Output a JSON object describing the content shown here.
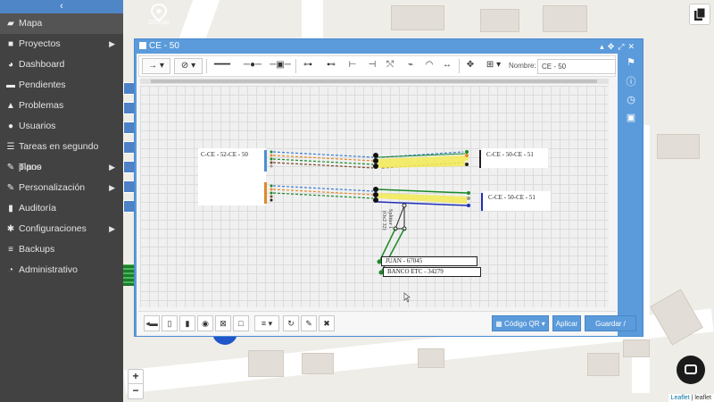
{
  "sidebar": {
    "toggle_icon": "chevron-left-icon",
    "items": [
      {
        "label": "Mapa",
        "icon": "map-icon",
        "submenu": false
      },
      {
        "label": "Proyectos",
        "icon": "folder-icon",
        "submenu": true
      },
      {
        "label": "Dashboard",
        "icon": "pie-chart-icon",
        "submenu": false
      },
      {
        "label": "Pendientes",
        "icon": "truck-icon",
        "submenu": false
      },
      {
        "label": "Problemas",
        "icon": "warning-icon",
        "submenu": false
      },
      {
        "label": "Usuarios",
        "icon": "user-icon",
        "submenu": false
      },
      {
        "label": "Tareas en segundo plano",
        "icon": "tasks-icon",
        "submenu": false
      },
      {
        "label": "Tipos",
        "icon": "wrench-icon",
        "submenu": true
      },
      {
        "label": "Personalización",
        "icon": "brush-icon",
        "submenu": true
      },
      {
        "label": "Auditoría",
        "icon": "book-icon",
        "submenu": false
      },
      {
        "label": "Configuraciones",
        "icon": "gear-icon",
        "submenu": true
      },
      {
        "label": "Backups",
        "icon": "database-icon",
        "submenu": false
      },
      {
        "label": "Administrativo",
        "icon": "dashboard-icon",
        "submenu": false
      }
    ]
  },
  "logo": {
    "text": "OZmap"
  },
  "dialog": {
    "title": "CE - 50",
    "toolbar": {
      "name_label": "Nombre:",
      "name_value": "CE - 50"
    },
    "bottombar": {
      "qr_label": "Código QR",
      "apply_label": "Aplicar",
      "save_close_label": "Guardar / Cerrar"
    }
  },
  "diagram": {
    "left_box_label": "C-CE - 52-CE - 50",
    "right_box_top_label": "C-CE - 50-CE - 51",
    "right_box_bottom_label": "C-CE - 50-CE - 51",
    "splitter_label": "Splitter 1",
    "splitter_sublabel": "(Oe2 32)",
    "clients": [
      {
        "label": "JUAN - 67045"
      },
      {
        "label": "BANCO ETC - 34279"
      }
    ]
  },
  "map": {
    "zoom_in": "+",
    "zoom_out": "−",
    "attribution_link": "Leaflet",
    "attribution_text": " | leaflet"
  },
  "colors": {
    "sidebar_bg": "#424242",
    "accent": "#5b9bdb",
    "fiber_green": "#1a8a2a",
    "fiber_blue": "#1f2fb5",
    "fiber_yellow": "#f2ea5c",
    "fiber_orange": "#e58a2a"
  }
}
